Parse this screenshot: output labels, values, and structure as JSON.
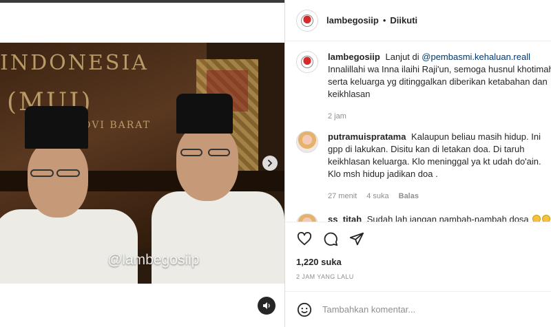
{
  "post": {
    "author": "lambegosiip",
    "follow_separator": "•",
    "follow_status": "Diikuti",
    "watermark": "@lambegosiip"
  },
  "video_scene": {
    "wall_text_line1": "INDONESIA",
    "wall_text_line2": "(MUI)",
    "wall_text_line3": "OVI   BARAT"
  },
  "comments": [
    {
      "username": "lambegosiip",
      "text_before": "Lanjut di",
      "mention": "@pembasmi.kehaluan.reall",
      "text_after": "Innalillahi wa Inna ilaihi Raji'un, semoga husnul khotimah serta keluarga yg ditinggalkan diberikan ketabahan dan keikhlasan",
      "time": "2 jam"
    },
    {
      "username": "putramuispratama",
      "text": "Kalaupun beliau masih hidup. Ini gpp di lakukan. Disitu kan di letakan doa. Di taruh keikhlasan keluarga. Klo meninggal ya kt udah do'ain. Klo msh hidup jadikan doa .",
      "time": "27 menit",
      "likes": "4 suka",
      "reply": "Balas"
    },
    {
      "username": "ss_titah",
      "text": "Sudah lah jangan nambah-nambah dosa"
    }
  ],
  "actions": {
    "likes_count": "1,220 suka",
    "posted_ago": "2 JAM YANG LALU",
    "comment_placeholder": "Tambahkan komentar..."
  }
}
